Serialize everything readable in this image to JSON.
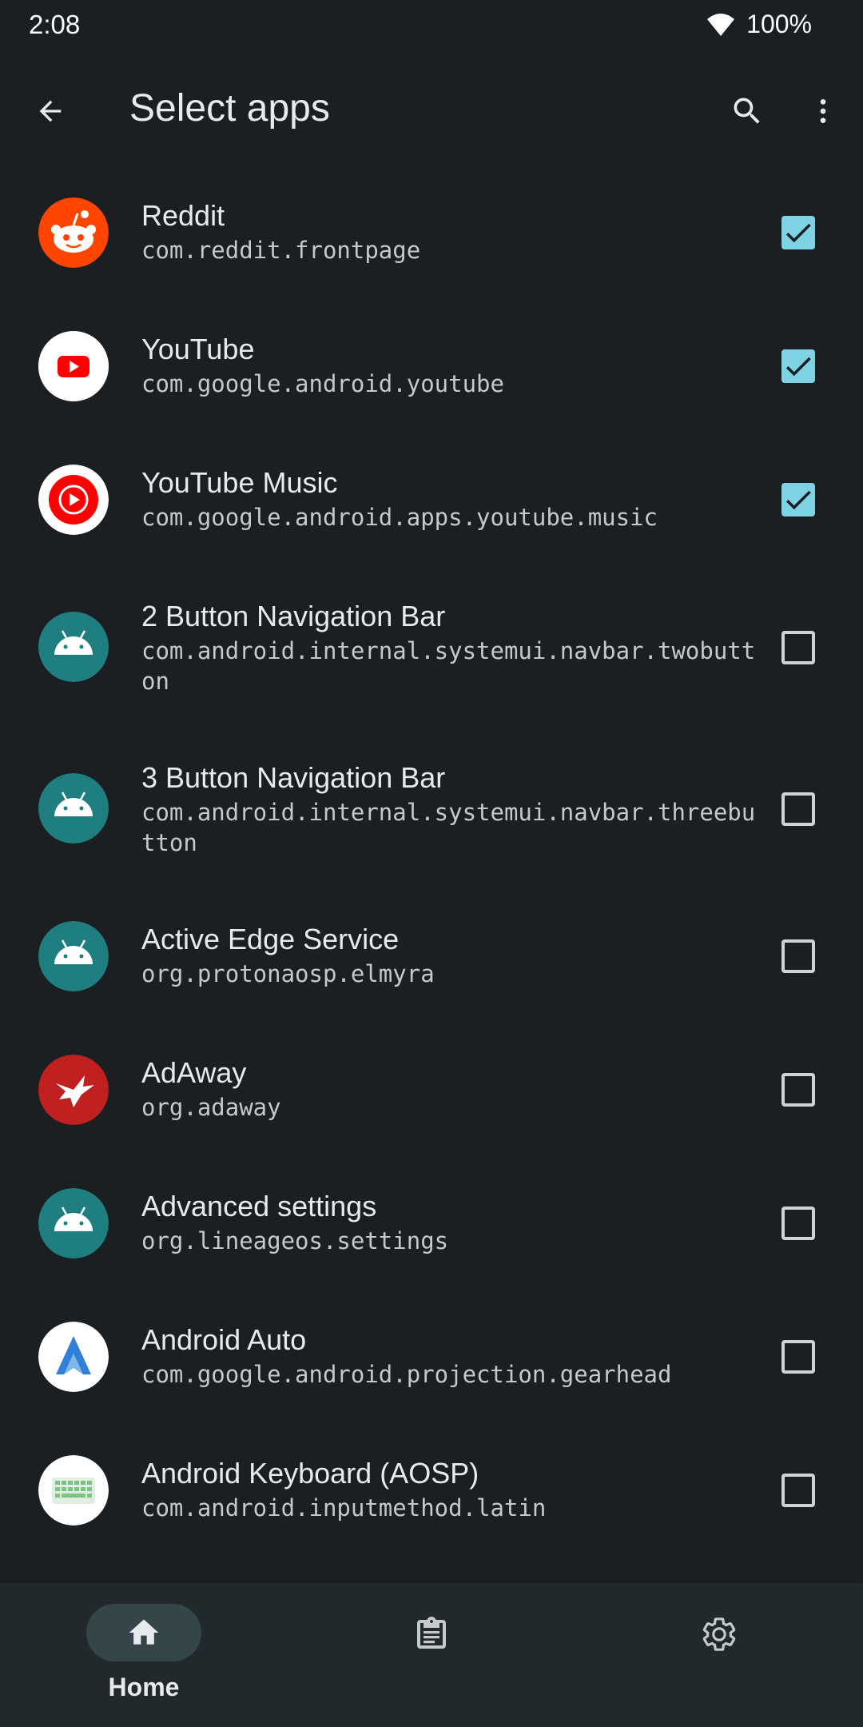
{
  "status": {
    "time": "2:08",
    "battery": "100%"
  },
  "header": {
    "title": "Select apps"
  },
  "icons": {
    "back": "arrow-back-icon",
    "search": "search-icon",
    "more": "more-vert-icon",
    "home": "home-icon",
    "clipboard": "clipboard-icon",
    "settings": "gear-icon"
  },
  "colors": {
    "background": "#1b1f21",
    "checkbox_checked": "#7dd3e4",
    "nav_background": "#21292c",
    "nav_pill": "#344649"
  },
  "apps": [
    {
      "name": "Reddit",
      "package": "com.reddit.frontpage",
      "checked": true,
      "icon": "reddit-icon"
    },
    {
      "name": "YouTube",
      "package": "com.google.android.youtube",
      "checked": true,
      "icon": "youtube-icon"
    },
    {
      "name": "YouTube Music",
      "package": "com.google.android.apps.youtube.music",
      "checked": true,
      "icon": "youtube-music-icon"
    },
    {
      "name": "2 Button Navigation Bar",
      "package": "com.android.internal.systemui.navbar.twobutton",
      "checked": false,
      "icon": "android-icon"
    },
    {
      "name": "3 Button Navigation Bar",
      "package": "com.android.internal.systemui.navbar.threebutton",
      "checked": false,
      "icon": "android-icon"
    },
    {
      "name": "Active Edge Service",
      "package": "org.protonaosp.elmyra",
      "checked": false,
      "icon": "android-icon"
    },
    {
      "name": "AdAway",
      "package": "org.adaway",
      "checked": false,
      "icon": "adaway-icon"
    },
    {
      "name": "Advanced settings",
      "package": "org.lineageos.settings",
      "checked": false,
      "icon": "android-icon"
    },
    {
      "name": "Android Auto",
      "package": "com.google.android.projection.gearhead",
      "checked": false,
      "icon": "android-auto-icon"
    },
    {
      "name": "Android Keyboard (AOSP)",
      "package": "com.android.inputmethod.latin",
      "checked": false,
      "icon": "keyboard-icon"
    }
  ],
  "nav": {
    "home_label": "Home"
  }
}
